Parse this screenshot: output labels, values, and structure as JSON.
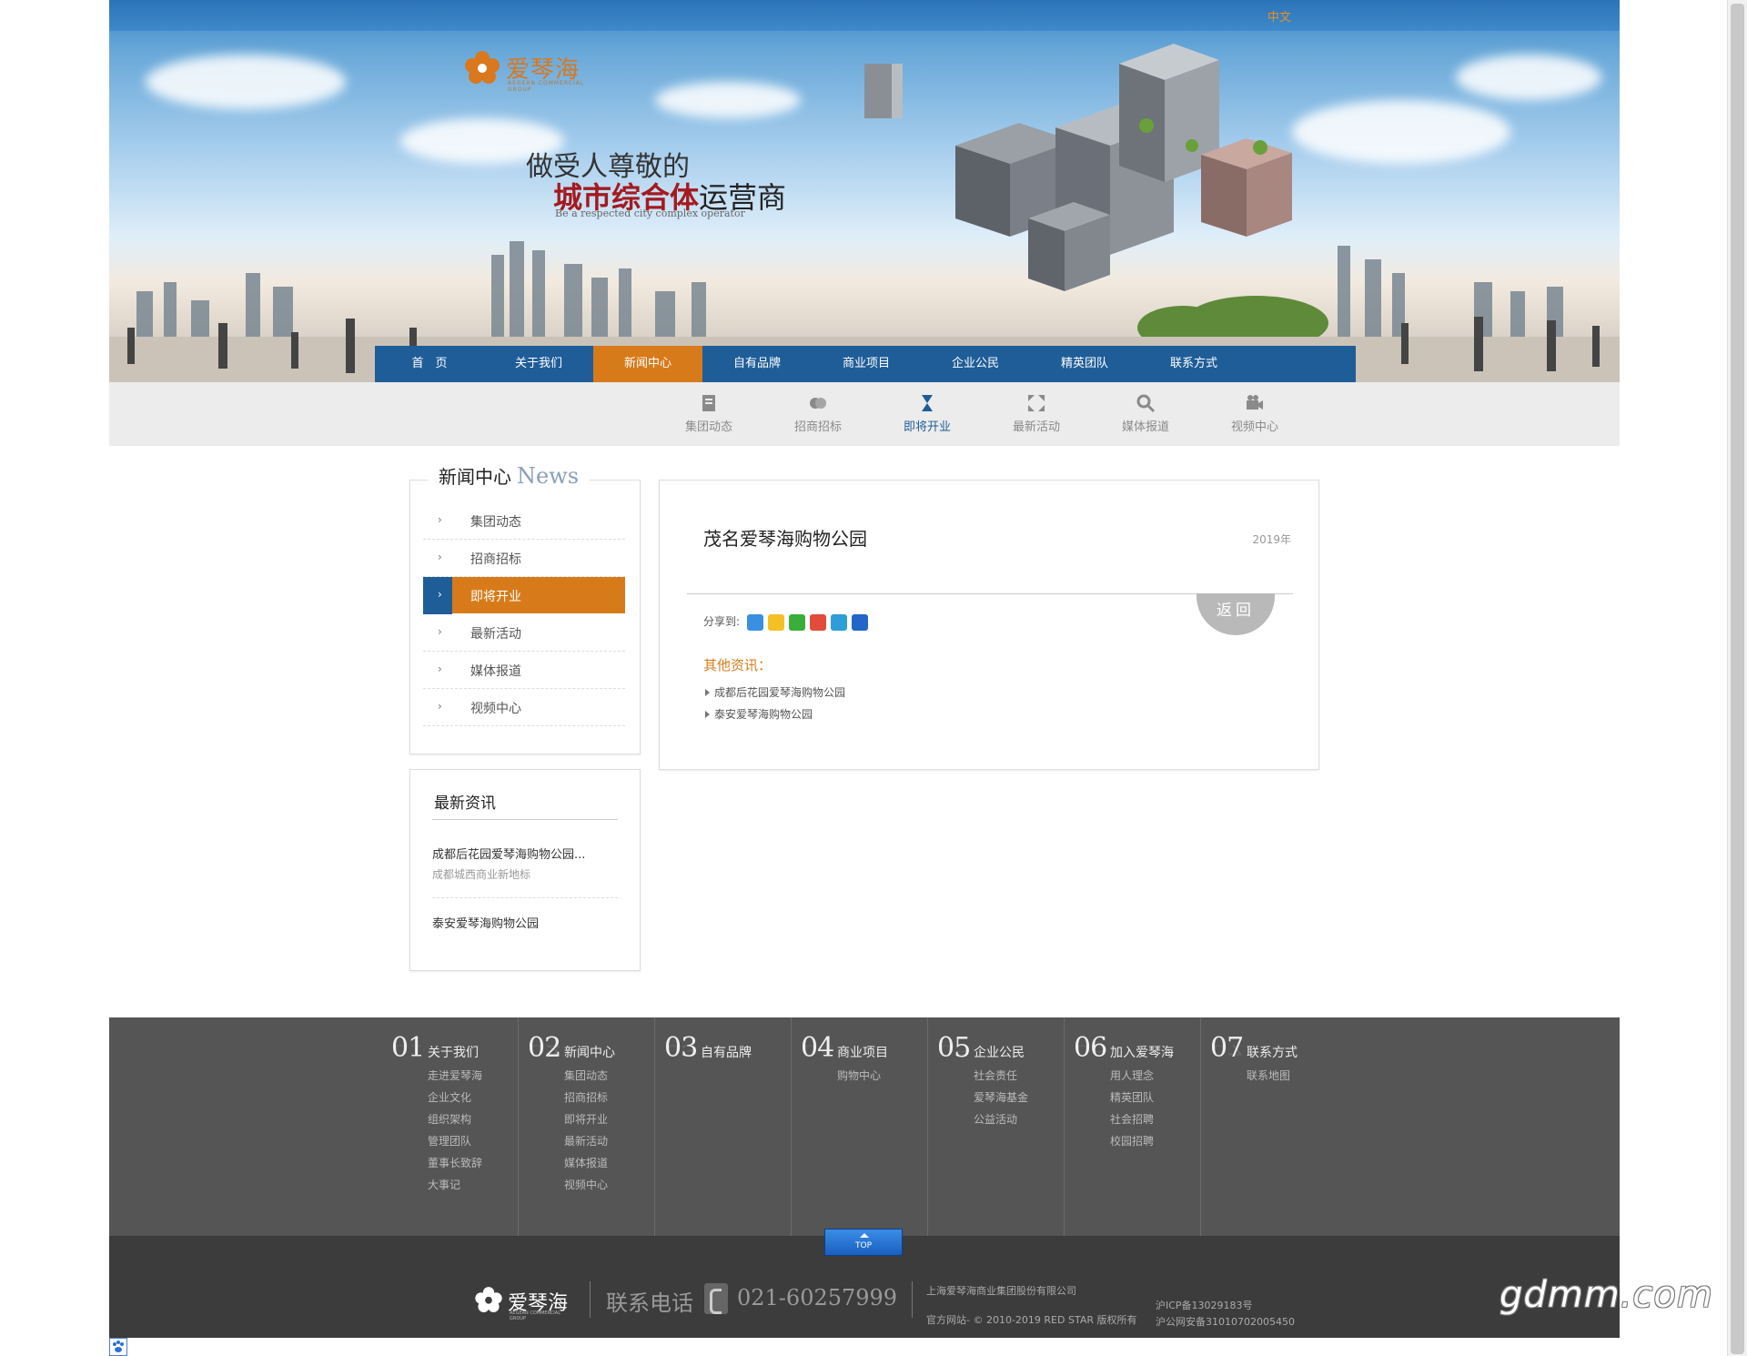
{
  "header": {
    "lang": "中文",
    "logo_name": "爱琴海",
    "logo_sub": "AEGEAN COMMERCIAL GROUP",
    "slogan_line1": "做受人尊敬的",
    "slogan_red": "城市综合体",
    "slogan_rest": "运营商",
    "slogan_en": "Be a respected city complex operator"
  },
  "main_nav": [
    {
      "label": "首　页"
    },
    {
      "label": "关于我们"
    },
    {
      "label": "新闻中心"
    },
    {
      "label": "自有品牌"
    },
    {
      "label": "商业项目"
    },
    {
      "label": "企业公民"
    },
    {
      "label": "精英团队"
    },
    {
      "label": "联系方式"
    }
  ],
  "sub_nav": [
    {
      "label": "集团动态",
      "icon": "document-icon"
    },
    {
      "label": "招商招标",
      "icon": "handshake-icon"
    },
    {
      "label": "即将开业",
      "icon": "hourglass-icon"
    },
    {
      "label": "最新活动",
      "icon": "expand-icon"
    },
    {
      "label": "媒体报道",
      "icon": "magnifier-icon"
    },
    {
      "label": "视频中心",
      "icon": "video-camera-icon"
    }
  ],
  "sidebar": {
    "title": "新闻中心",
    "title_en": "News",
    "categories": [
      {
        "label": "集团动态"
      },
      {
        "label": "招商招标"
      },
      {
        "label": "即将开业"
      },
      {
        "label": "最新活动"
      },
      {
        "label": "媒体报道"
      },
      {
        "label": "视频中心"
      }
    ],
    "latest_title": "最新资讯",
    "latest": [
      {
        "title": "成都后花园爱琴海购物公园...",
        "desc": "成都城西商业新地标"
      },
      {
        "title": "泰安爱琴海购物公园"
      }
    ]
  },
  "article": {
    "title": "茂名爱琴海购物公园",
    "date": "2019年",
    "back_label": "返回",
    "share_label": "分享到:",
    "other_title": "其他资讯：",
    "other": [
      "成都后花园爱琴海购物公园",
      "泰安爱琴海购物公园"
    ]
  },
  "footer": {
    "columns": [
      {
        "num": "01",
        "title": "关于我们",
        "links": [
          "走进爱琴海",
          "企业文化",
          "组织架构",
          "管理团队",
          "董事长致辞",
          "大事记"
        ]
      },
      {
        "num": "02",
        "title": "新闻中心",
        "links": [
          "集团动态",
          "招商招标",
          "即将开业",
          "最新活动",
          "媒体报道",
          "视频中心"
        ]
      },
      {
        "num": "03",
        "title": "自有品牌",
        "links": []
      },
      {
        "num": "04",
        "title": "商业项目",
        "links": [
          "购物中心"
        ]
      },
      {
        "num": "05",
        "title": "企业公民",
        "links": [
          "社会责任",
          "爱琴海基金",
          "公益活动"
        ]
      },
      {
        "num": "06",
        "title": "加入爱琴海",
        "links": [
          "用人理念",
          "精英团队",
          "社会招聘",
          "校园招聘"
        ]
      },
      {
        "num": "07",
        "title": "联系方式",
        "links": [
          "联系地图"
        ]
      }
    ],
    "top_label": "TOP",
    "logo_name": "爱琴海",
    "logo_sub": "AEGEAN COMMERCIAL GROUP",
    "phone_label": "联系电话",
    "phone": "021-60257999",
    "company": "上海爱琴海商业集团股份有限公司",
    "copyright": "官方网站- © 2010-2019 RED STAR 版权所有",
    "icp1": "沪ICP备13029183号",
    "icp2": "沪公网安备31010702005450"
  },
  "watermark": "gdmm.com",
  "colors": {
    "brand_blue": "#1f5d98",
    "brand_orange": "#d77b1a",
    "footer_dark": "#3c3c3c",
    "footer_mid": "#555555"
  }
}
